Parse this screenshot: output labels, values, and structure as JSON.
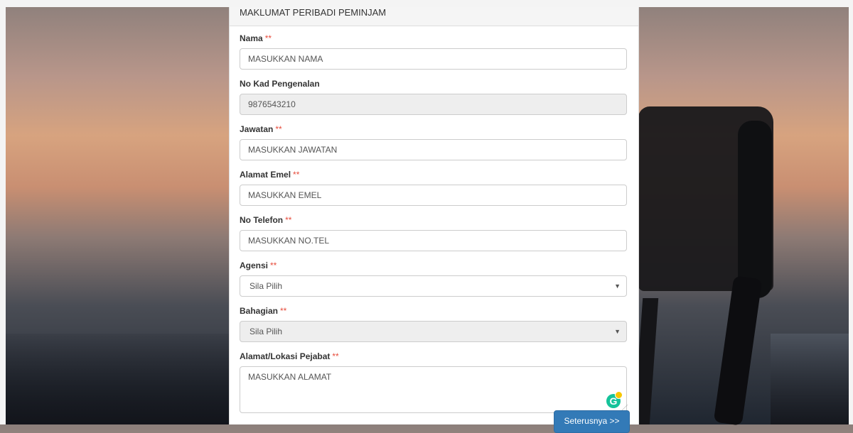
{
  "form": {
    "section_title": "MAKLUMAT PERIBADI PEMINJAM",
    "required_marker": "**",
    "fields": {
      "nama": {
        "label": "Nama",
        "placeholder": "MASUKKAN NAMA"
      },
      "no_kp": {
        "label": "No Kad Pengenalan",
        "value": "9876543210"
      },
      "jawatan": {
        "label": "Jawatan",
        "placeholder": "MASUKKAN JAWATAN"
      },
      "emel": {
        "label": "Alamat Emel",
        "placeholder": "MASUKKAN EMEL"
      },
      "telefon": {
        "label": "No Telefon",
        "placeholder": "MASUKKAN NO.TEL"
      },
      "agensi": {
        "label": "Agensi",
        "selected": "Sila Pilih"
      },
      "bahagian": {
        "label": "Bahagian",
        "selected": "Sila Pilih"
      },
      "alamat": {
        "label": "Alamat/Lokasi Pejabat",
        "placeholder": "MASUKKAN ALAMAT"
      }
    },
    "next_button_label": "Seterusnya >>"
  },
  "icons": {
    "dropdown": "caret-down-icon",
    "grammarly": "grammarly-icon"
  },
  "colors": {
    "required": "#e74c3c",
    "primary_button": "#337ab7",
    "grammarly": "#15c39a"
  }
}
